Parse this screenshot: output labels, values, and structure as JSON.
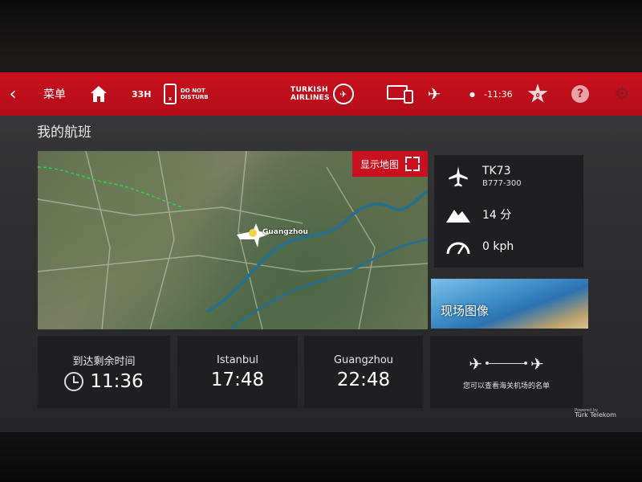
{
  "topbar": {
    "back_label": "‹",
    "menu_label": "菜单",
    "elapsed": "33H",
    "dnd_badge": "x",
    "dnd_line1": "DO NOT",
    "dnd_line2": "DISTURB",
    "brand_line1": "TURKISH",
    "brand_line2": "AIRLINES",
    "remaining": "-11:36",
    "star_count": "0"
  },
  "page_title": "我的航班",
  "map": {
    "show_map_label": "显示地图",
    "city_label": "Guangzhou"
  },
  "flight_info": {
    "flight_number": "TK73",
    "aircraft": "B777-300",
    "altitude": "14 分",
    "speed": "0 kph"
  },
  "live_camera_label": "现场图像",
  "tiles": {
    "remaining_label": "到达剩余时间",
    "remaining_time": "11:36",
    "origin_city": "Istanbul",
    "origin_time": "17:48",
    "dest_city": "Guangzhou",
    "dest_time": "22:48",
    "customs_text": "您可以查看海关机场的名单"
  },
  "footer": {
    "powered_by": "Powered by",
    "provider": "Türk Telekom"
  },
  "colors": {
    "brand_red": "#c8101e",
    "panel_bg": "#1f1f21",
    "screen_bg": "#2f2f31"
  }
}
